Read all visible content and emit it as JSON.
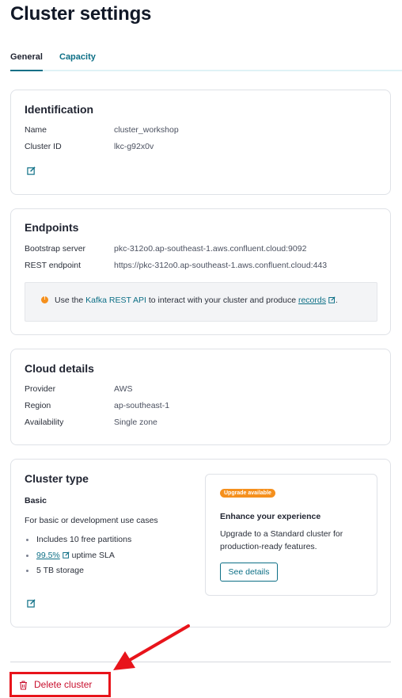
{
  "page": {
    "title": "Cluster settings"
  },
  "tabs": [
    {
      "label": "General",
      "active": true
    },
    {
      "label": "Capacity",
      "active": false
    }
  ],
  "identification": {
    "title": "Identification",
    "rows": [
      {
        "label": "Name",
        "value": "cluster_workshop"
      },
      {
        "label": "Cluster ID",
        "value": "lkc-g92x0v"
      }
    ],
    "edit_icon": "edit-icon"
  },
  "endpoints": {
    "title": "Endpoints",
    "rows": [
      {
        "label": "Bootstrap server",
        "value": "pkc-312o0.ap-southeast-1.aws.confluent.cloud:9092"
      },
      {
        "label": "REST endpoint",
        "value": "https://pkc-312o0.ap-southeast-1.aws.confluent.cloud:443"
      }
    ],
    "notice": {
      "icon": "info-icon",
      "pre": "Use the ",
      "link1": "Kafka REST API",
      "mid": " to interact with your cluster and produce ",
      "link2": "records",
      "post": "."
    }
  },
  "cloud_details": {
    "title": "Cloud details",
    "rows": [
      {
        "label": "Provider",
        "value": "AWS"
      },
      {
        "label": "Region",
        "value": "ap-southeast-1"
      },
      {
        "label": "Availability",
        "value": "Single zone"
      }
    ]
  },
  "cluster_type": {
    "title": "Cluster type",
    "type_name": "Basic",
    "description": "For basic or development use cases",
    "bullets": {
      "partitions": "Includes 10 free partitions",
      "sla_link": "99.5%",
      "sla_text": " uptime SLA",
      "storage": "5 TB storage"
    },
    "upsell": {
      "badge": "Upgrade available",
      "title": "Enhance your experience",
      "body": "Upgrade to a Standard cluster for production-ready features.",
      "button": "See details"
    }
  },
  "danger": {
    "delete_label": "Delete cluster"
  },
  "colors": {
    "accent": "#0d6f86",
    "warning": "#f5901d",
    "danger": "#c8102e",
    "highlight": "#e8141b"
  }
}
